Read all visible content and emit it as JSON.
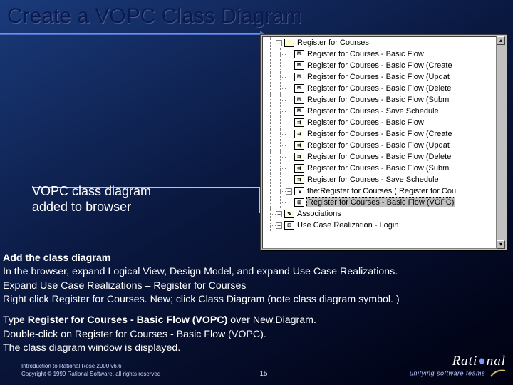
{
  "title": "Create a VOPC Class Diagram",
  "callout": {
    "line1": "VOPC class diagram",
    "line2": "added to browser"
  },
  "tree": {
    "items": [
      {
        "indent": 0,
        "box": "-",
        "icon": "pkg",
        "iconText": "",
        "label": "Register for Courses",
        "sel": false
      },
      {
        "indent": 1,
        "box": "",
        "icon": "seq",
        "iconText": "M↓",
        "label": "Register for Courses - Basic Flow",
        "sel": false
      },
      {
        "indent": 1,
        "box": "",
        "icon": "seq",
        "iconText": "M↓",
        "label": "Register for Courses - Basic Flow (Create",
        "sel": false
      },
      {
        "indent": 1,
        "box": "",
        "icon": "seq",
        "iconText": "M↓",
        "label": "Register for Courses - Basic Flow (Updat",
        "sel": false
      },
      {
        "indent": 1,
        "box": "",
        "icon": "seq",
        "iconText": "M↓",
        "label": "Register for Courses - Basic Flow (Delete",
        "sel": false
      },
      {
        "indent": 1,
        "box": "",
        "icon": "seq",
        "iconText": "M↓",
        "label": "Register for Courses - Basic Flow (Submi",
        "sel": false
      },
      {
        "indent": 1,
        "box": "",
        "icon": "seq",
        "iconText": "M↓",
        "label": "Register for Courses - Save Schedule",
        "sel": false
      },
      {
        "indent": 1,
        "box": "",
        "icon": "col",
        "iconText": "⇉",
        "label": "Register for Courses - Basic Flow",
        "sel": false
      },
      {
        "indent": 1,
        "box": "",
        "icon": "col",
        "iconText": "⇉",
        "label": "Register for Courses - Basic Flow (Create",
        "sel": false
      },
      {
        "indent": 1,
        "box": "",
        "icon": "col",
        "iconText": "⇉",
        "label": "Register for Courses - Basic Flow (Updat",
        "sel": false
      },
      {
        "indent": 1,
        "box": "",
        "icon": "col",
        "iconText": "⇉",
        "label": "Register for Courses - Basic Flow (Delete",
        "sel": false
      },
      {
        "indent": 1,
        "box": "",
        "icon": "col",
        "iconText": "⇉",
        "label": "Register for Courses - Basic Flow (Submi",
        "sel": false
      },
      {
        "indent": 1,
        "box": "",
        "icon": "col",
        "iconText": "⇉",
        "label": "Register for Courses - Save Schedule",
        "sel": false
      },
      {
        "indent": 1,
        "box": "+",
        "icon": "link",
        "iconText": "↘",
        "label": "the:Register for Courses ( Register for Cou",
        "sel": false
      },
      {
        "indent": 1,
        "box": "",
        "icon": "cls",
        "iconText": "⊞",
        "label": "Register for Courses - Basic Flow (VOPC)",
        "sel": true
      },
      {
        "indent": 0,
        "box": "+",
        "icon": "note",
        "iconText": "✎",
        "label": "Associations",
        "sel": false
      },
      {
        "indent": 0,
        "box": "+",
        "icon": "diag",
        "iconText": "⊡",
        "label": "Use Case Realization - Login",
        "sel": false
      }
    ]
  },
  "instructions": {
    "header": "Add the class diagram",
    "p1": "In the browser, expand  Logical View, Design Model, and  expand Use Case Realizations.",
    "p2": "Expand Use Case Realizations – Register for Courses",
    "p3": "Right click Register for Courses.  New; click Class Diagram (note class diagram symbol. )",
    "p4a": "Type ",
    "p4b": "Register for Courses - Basic Flow (VOPC)",
    "p4c": "  over New.Diagram.",
    "p5": " Double-click on Register for Courses - Basic Flow (VOPC).",
    "p6": " The class diagram window is displayed."
  },
  "footer": {
    "line1": "Introduction to Rational Rose 2000 v6.6",
    "line2": "Copyright © 1999 Rational Software, all rights reserved",
    "page": "15",
    "brand": "Rati nal",
    "tagline": "unifying software teams"
  }
}
